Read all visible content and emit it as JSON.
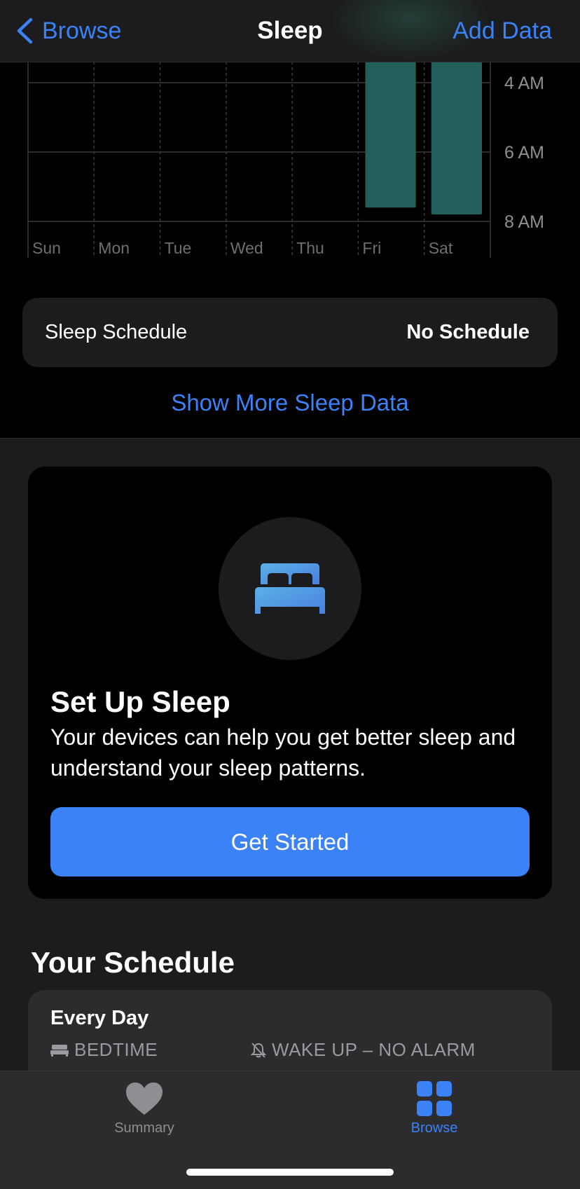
{
  "nav": {
    "back_label": "Browse",
    "title": "Sleep",
    "right_action": "Add Data"
  },
  "chart_data": {
    "type": "bar",
    "categories": [
      "Sun",
      "Mon",
      "Tue",
      "Wed",
      "Thu",
      "Fri",
      "Sat"
    ],
    "y_tick_labels": [
      "4 AM",
      "6 AM",
      "8 AM"
    ],
    "bar_end_hours": [
      null,
      null,
      null,
      null,
      null,
      7.6,
      7.8
    ],
    "bar_color": "#225f5b"
  },
  "sleep_schedule": {
    "label": "Sleep Schedule",
    "value": "No Schedule"
  },
  "show_more_label": "Show More Sleep Data",
  "setup": {
    "title": "Set Up Sleep",
    "description": "Your devices can help you get better sleep and understand your sleep patterns.",
    "button_label": "Get Started"
  },
  "your_schedule": {
    "heading": "Your Schedule",
    "frequency": "Every Day",
    "bedtime_label": "BEDTIME",
    "wake_label": "WAKE UP – NO ALARM"
  },
  "tabs": [
    {
      "label": "Summary",
      "icon": "heart-icon",
      "active": false
    },
    {
      "label": "Browse",
      "icon": "grid-icon",
      "active": true
    }
  ],
  "colors": {
    "accent": "#3b82f6",
    "bar": "#225f5b",
    "inactive_tab": "#8e8e93"
  }
}
